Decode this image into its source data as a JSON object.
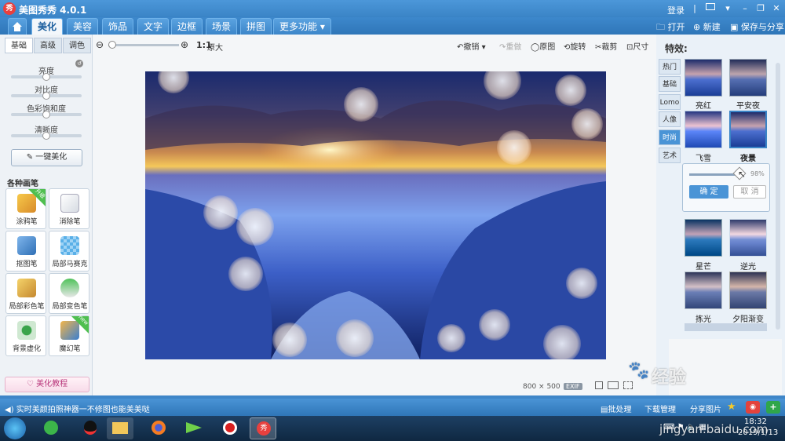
{
  "app": {
    "title": "美图秀秀 4.0.1",
    "logo_text": "秀",
    "login": "登录"
  },
  "nav": {
    "tabs": [
      "美化",
      "美容",
      "饰品",
      "文字",
      "边框",
      "场景",
      "拼图",
      "更多功能"
    ],
    "open": "打开",
    "new": "新建",
    "save_share": "保存与分享"
  },
  "toolbar": {
    "zoom_ratio": "1:1",
    "original_size": "原大",
    "undo": "撤销",
    "redo": "重做",
    "original_image": "原图",
    "rotate": "旋转",
    "crop": "裁剪",
    "size": "尺寸"
  },
  "left_panel": {
    "tabs": [
      "基础",
      "高级",
      "调色"
    ],
    "sliders": [
      "亮度",
      "对比度",
      "色彩饱和度",
      "清晰度"
    ],
    "one_click": "一键美化",
    "brushes_title": "各种画笔",
    "brushes": [
      {
        "label": "涂鸦笔",
        "badge": "升级"
      },
      {
        "label": "消除笔",
        "badge": ""
      },
      {
        "label": "抠图笔",
        "badge": ""
      },
      {
        "label": "局部马赛克",
        "badge": ""
      },
      {
        "label": "局部彩色笔",
        "badge": ""
      },
      {
        "label": "局部变色笔",
        "badge": ""
      },
      {
        "label": "背景虚化",
        "badge": ""
      },
      {
        "label": "魔幻笔",
        "badge": "new"
      }
    ],
    "tutorial": "美化教程"
  },
  "canvas": {
    "dimensions": "800 × 500",
    "exif": "EXIF"
  },
  "right_panel": {
    "title": "特效:",
    "categories": [
      "热门",
      "基础",
      "Lomo",
      "人像",
      "时尚",
      "艺术"
    ],
    "active_category": "时尚",
    "effects_top": [
      "亮红",
      "平安夜",
      "飞雪",
      "夜景"
    ],
    "selected_effect": "夜景",
    "intensity": "98%",
    "intensity_value": 0.98,
    "confirm": "确 定",
    "cancel": "取 消",
    "effects_bottom": [
      "星芒",
      "逆光",
      "拣光",
      "夕阳渐变"
    ]
  },
  "status": {
    "promo": "实时美颜拍照神器一不修图也能美美哒",
    "batch": "批处理",
    "download_mgr": "下载管理",
    "share_image": "分享图片"
  },
  "taskbar": {
    "time": "18:32",
    "date": "2019/1/13"
  },
  "watermark": "Bai 经验 jingyan.baidu.com",
  "colors": {
    "title_bar": "#3a84c6",
    "status_bar": "#2f76b8",
    "accent": "#4a94d6"
  }
}
